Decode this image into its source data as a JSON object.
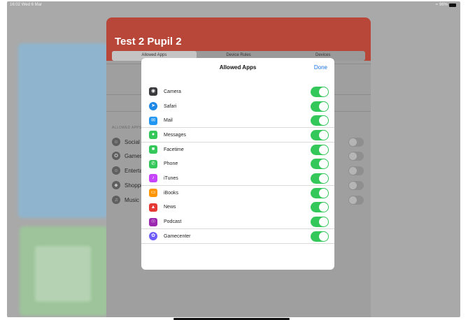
{
  "status_bar": {
    "time": "16:02",
    "date": "Wed 6 Mar",
    "battery": "96%"
  },
  "sheet": {
    "title": "Test 2 Pupil 2",
    "segments": [
      "Allowed Apps",
      "Device Rules",
      "Devices"
    ],
    "section_label": "ALLOWED APPS",
    "categories": [
      {
        "label": "Social",
        "icon": "social-icon"
      },
      {
        "label": "Games",
        "icon": "games-icon"
      },
      {
        "label": "Entertainment",
        "icon": "entertainment-icon"
      },
      {
        "label": "Shopping",
        "icon": "shopping-icon"
      },
      {
        "label": "Music",
        "icon": "music-icon"
      }
    ]
  },
  "modal": {
    "title": "Allowed Apps",
    "done_label": "Done",
    "apps": [
      {
        "label": "Camera",
        "icon": "camera-icon",
        "color": "#3a3a3c",
        "enabled": true
      },
      {
        "label": "Safari",
        "icon": "safari-icon",
        "color": "#1e88e5",
        "enabled": true
      },
      {
        "label": "Mail",
        "icon": "mail-icon",
        "color": "#2196f3",
        "enabled": true
      },
      {
        "label": "Messages",
        "icon": "messages-icon",
        "color": "#34c759",
        "enabled": true
      },
      {
        "label": "Facetime",
        "icon": "facetime-icon",
        "color": "#34c759",
        "enabled": true
      },
      {
        "label": "Phone",
        "icon": "phone-icon",
        "color": "#34c759",
        "enabled": true
      },
      {
        "label": "iTunes",
        "icon": "itunes-icon",
        "color": "#c644fc",
        "enabled": true
      },
      {
        "label": "iBooks",
        "icon": "ibooks-icon",
        "color": "#ff9500",
        "enabled": true
      },
      {
        "label": "News",
        "icon": "news-icon",
        "color": "#e53935",
        "enabled": true
      },
      {
        "label": "Podcast",
        "icon": "podcast-icon",
        "color": "#9c27b0",
        "enabled": true
      },
      {
        "label": "Gamecenter",
        "icon": "gamecenter-icon",
        "color": "#6d5dfc",
        "enabled": true
      }
    ]
  },
  "colors": {
    "accent": "#1a73e8",
    "toggle_on": "#34c759",
    "header": "#c0392b"
  }
}
